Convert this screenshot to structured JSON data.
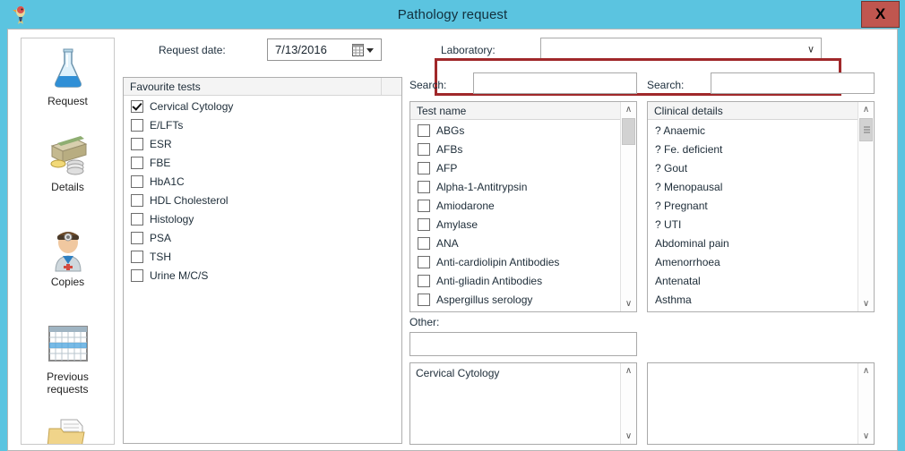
{
  "window": {
    "title": "Pathology request",
    "close_label": "X",
    "titlebar_color": "#5bc4e0",
    "close_button_color": "#c0564f",
    "highlight_color": "#a0282a"
  },
  "sidebar": {
    "items": [
      {
        "label": "Request",
        "icon": "flask-icon"
      },
      {
        "label": "Details",
        "icon": "money-icon"
      },
      {
        "label": "Copies",
        "icon": "doctor-icon"
      },
      {
        "label": "Previous\nrequests",
        "label_line1": "Previous",
        "label_line2": "requests",
        "icon": "calendar-icon"
      },
      {
        "label": "",
        "icon": "folder-documents-icon"
      }
    ]
  },
  "header": {
    "request_date_label": "Request date:",
    "request_date_value": "7/13/2016",
    "laboratory_label": "Laboratory:",
    "laboratory_value": "",
    "laboratory_options": []
  },
  "favourites": {
    "header": "Favourite tests",
    "items": [
      {
        "label": "Cervical Cytology",
        "checked": true
      },
      {
        "label": "E/LFTs",
        "checked": false
      },
      {
        "label": "ESR",
        "checked": false
      },
      {
        "label": "FBE",
        "checked": false
      },
      {
        "label": "HbA1C",
        "checked": false
      },
      {
        "label": "HDL Cholesterol",
        "checked": false
      },
      {
        "label": "Histology",
        "checked": false
      },
      {
        "label": "PSA",
        "checked": false
      },
      {
        "label": "TSH",
        "checked": false
      },
      {
        "label": "Urine M/C/S",
        "checked": false
      }
    ]
  },
  "tests": {
    "search_label": "Search:",
    "search_value": "",
    "header": "Test name",
    "items": [
      {
        "label": "ABGs",
        "checked": false
      },
      {
        "label": "AFBs",
        "checked": false
      },
      {
        "label": "AFP",
        "checked": false
      },
      {
        "label": "Alpha-1-Antitrypsin",
        "checked": false
      },
      {
        "label": "Amiodarone",
        "checked": false
      },
      {
        "label": "Amylase",
        "checked": false
      },
      {
        "label": "ANA",
        "checked": false
      },
      {
        "label": "Anti-cardiolipin Antibodies",
        "checked": false
      },
      {
        "label": "Anti-gliadin Antibodies",
        "checked": false
      },
      {
        "label": "Aspergillus serology",
        "checked": false
      }
    ],
    "other_label": "Other:",
    "other_value": "",
    "selected_tests": "Cervical Cytology"
  },
  "clinical": {
    "search_label": "Search:",
    "search_value": "",
    "header": "Clinical details",
    "items": [
      {
        "label": "? Anaemic"
      },
      {
        "label": "? Fe. deficient"
      },
      {
        "label": "? Gout"
      },
      {
        "label": "? Menopausal"
      },
      {
        "label": "? Pregnant"
      },
      {
        "label": "? UTI"
      },
      {
        "label": "Abdominal pain"
      },
      {
        "label": "Amenorrhoea"
      },
      {
        "label": "Antenatal"
      },
      {
        "label": "Asthma"
      }
    ],
    "selected_details": ""
  },
  "icons": {
    "scroll_up": "∧",
    "scroll_down": "∨",
    "combo_chevron": "∨"
  }
}
